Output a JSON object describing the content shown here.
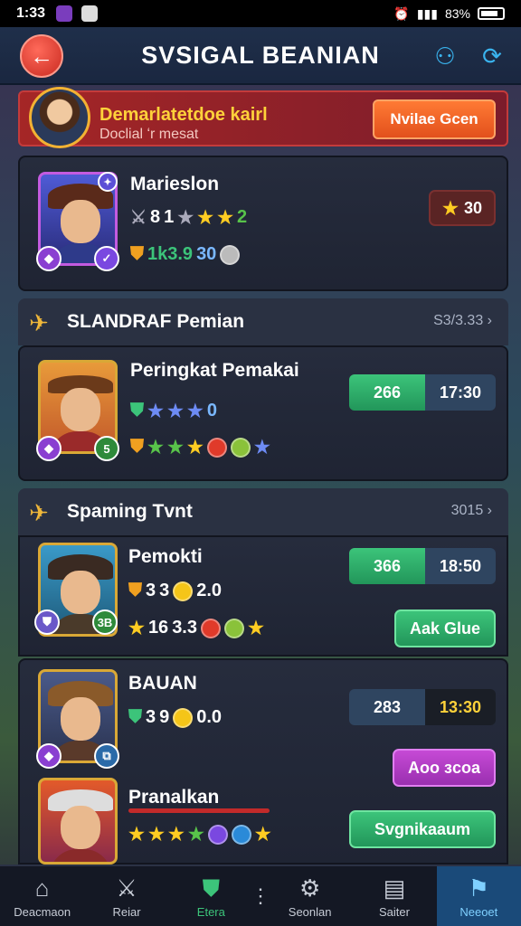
{
  "status": {
    "time": "1:33",
    "battery": "83%"
  },
  "header": {
    "title": "SVSIGAL BEANIAN"
  },
  "banner": {
    "title": "Demarlatetdoe kairl",
    "subtitle": "Doclial ʻr mesat",
    "button": "Nvilae Gcen"
  },
  "top_card": {
    "name": "Marieslon",
    "line1": [
      "8",
      "1",
      "2"
    ],
    "line2": [
      "1k3.9",
      "30"
    ],
    "badge": "30"
  },
  "section1": {
    "title": "SLANDRAF Pemian",
    "more": "S3/3.33"
  },
  "rank_card": {
    "name": "Peringkat Pemakai",
    "line1": [
      "0"
    ],
    "pill_a": "266",
    "pill_b": "17:30",
    "badge": "5"
  },
  "section2": {
    "title": "Spaming Tvnt",
    "more": "3015"
  },
  "players": [
    {
      "name": "Pemokti",
      "line1": [
        "3",
        "3",
        "2.0"
      ],
      "line2": [
        "16",
        "3.3"
      ],
      "pill_a": "366",
      "pill_b": "18:50",
      "button": "Aak Glue",
      "badge": "3B"
    },
    {
      "name": "BAUAN",
      "line1": [
        "3",
        "9",
        "0.0"
      ],
      "pill_a": "283",
      "pill_b": "13:30",
      "button": "Aoo ɜcoa"
    },
    {
      "name": "Pranalkan",
      "button": "Svgnikaaum"
    }
  ],
  "tabs": [
    {
      "label": "Deacmaon",
      "icon": "home-icon"
    },
    {
      "label": "Reiar",
      "icon": "sword-icon"
    },
    {
      "label": "Etera",
      "icon": "shield-icon"
    },
    {
      "label": "Seonlan",
      "icon": "gear-icon"
    },
    {
      "label": "Saiter",
      "icon": "scroll-icon"
    },
    {
      "label": "Neeoet",
      "icon": "flag-icon",
      "active": true
    }
  ],
  "colors": {
    "accent_green": "#22965a",
    "accent_orange": "#e2501c",
    "accent_purple": "#b13fc3",
    "active_tab": "#1a4a79"
  }
}
